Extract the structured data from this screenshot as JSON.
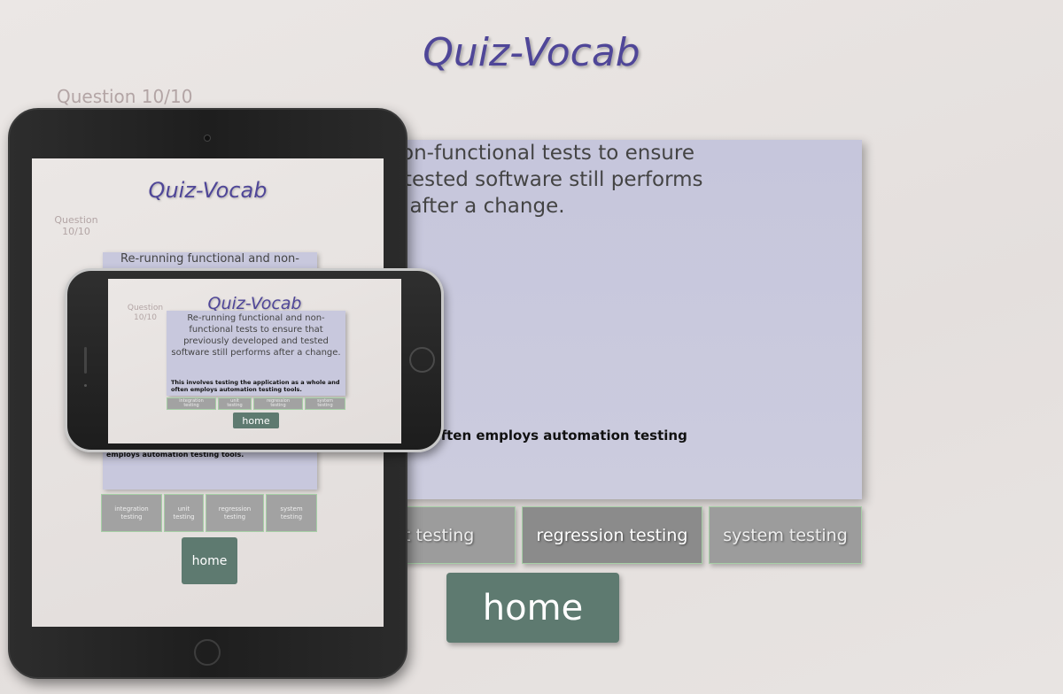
{
  "app": {
    "title": "Quiz-Vocab",
    "question_counter": "Question 10/10",
    "question_counter_line1": "Question",
    "question_counter_line2": "10/10"
  },
  "desktop": {
    "question_lines": [
      "tional and non-functional tests to ensure",
      "veloped and tested software still performs",
      "after a change."
    ],
    "hint": "ion as a whole and often employs automation testing",
    "options": [
      "unit testing",
      "regression testing",
      "system testing"
    ],
    "home_label": "home"
  },
  "tablet": {
    "question_visible": "Re-running functional and non-",
    "hint_visible": "employs automation testing tools.",
    "options": [
      [
        "integration",
        "testing"
      ],
      [
        "unit",
        "testing"
      ],
      [
        "regression",
        "testing"
      ],
      [
        "system",
        "testing"
      ]
    ],
    "home_label": "home"
  },
  "phone": {
    "question": "Re-running functional and non-functional tests to ensure that previously developed and tested software still performs after a change.",
    "hint": "This involves testing the application as a whole and often employs automation testing tools.",
    "options": [
      [
        "integration",
        "testing"
      ],
      [
        "unit",
        "testing"
      ],
      [
        "regression",
        "testing"
      ],
      [
        "system",
        "testing"
      ]
    ],
    "home_label": "home"
  },
  "colors": {
    "title": "#4f4698",
    "card": "#c8c8dd",
    "home_button": "#5e7a70",
    "option": "#9c9c9c",
    "option_border": "#a6cfa6"
  }
}
